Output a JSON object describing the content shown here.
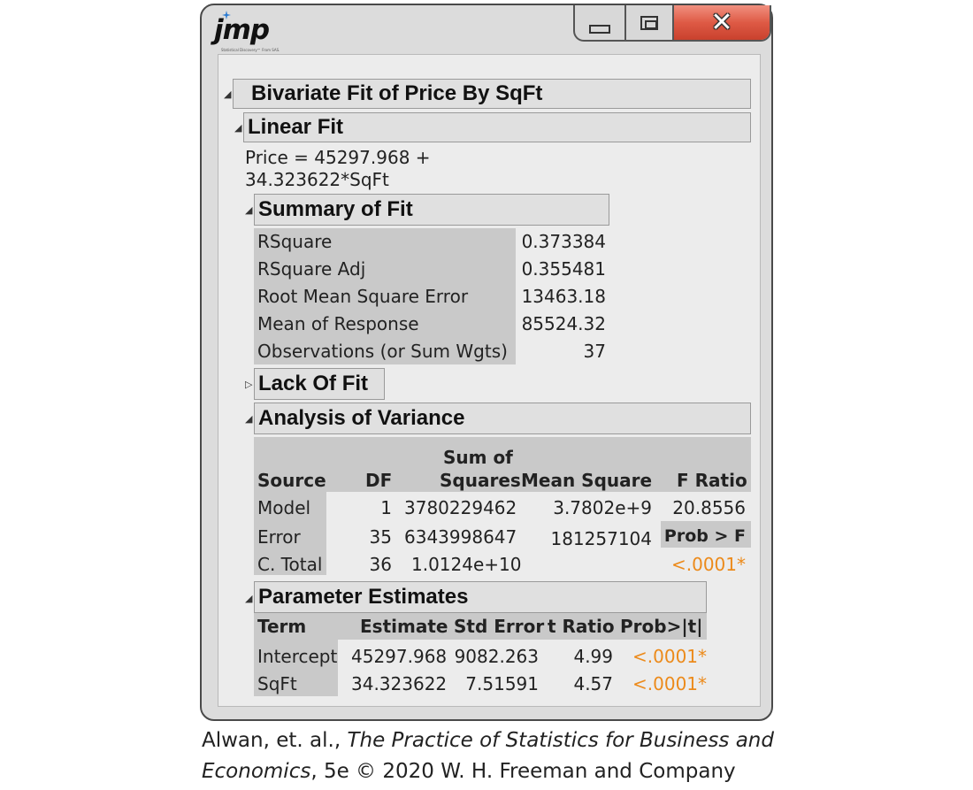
{
  "window": {
    "logo_text": "jmp",
    "logo_tagline": "Statistical Discovery™ From SAS."
  },
  "report": {
    "title": "Bivariate Fit of Price By SqFt",
    "linear_fit": {
      "title": "Linear Fit",
      "equation_line1": "Price = 45297.968 +",
      "equation_line2": "34.323622*SqFt"
    },
    "summary_of_fit": {
      "title": "Summary of Fit",
      "rows": [
        {
          "label": "RSquare",
          "value": "0.373384"
        },
        {
          "label": "RSquare Adj",
          "value": "0.355481"
        },
        {
          "label": "Root Mean Square Error",
          "value": "13463.18"
        },
        {
          "label": "Mean of Response",
          "value": "85524.32"
        },
        {
          "label": "Observations (or Sum Wgts)",
          "value": "37"
        }
      ]
    },
    "lack_of_fit": {
      "title": "Lack Of Fit"
    },
    "anova": {
      "title": "Analysis of Variance",
      "headers": {
        "source": "Source",
        "df": "DF",
        "ss_line1": "Sum of",
        "ss_line2": "Squares",
        "ms": "Mean Square",
        "f": "F Ratio"
      },
      "rows": [
        {
          "source": "Model",
          "df": "1",
          "ss": "3780229462",
          "ms": "3.7802e+9",
          "extra": "20.8556"
        },
        {
          "source": "Error",
          "df": "35",
          "ss": "6343998647",
          "ms": "181257104",
          "extra": "Prob > F"
        },
        {
          "source": "C. Total",
          "df": "36",
          "ss": "1.0124e+10",
          "ms": "",
          "extra": "<.0001*"
        }
      ]
    },
    "parameter_estimates": {
      "title": "Parameter Estimates",
      "headers": {
        "term": "Term",
        "estimate": "Estimate",
        "std_error": "Std Error",
        "t_ratio": "t Ratio",
        "prob": "Prob>|t|"
      },
      "rows": [
        {
          "term": "Intercept",
          "estimate": "45297.968",
          "std_error": "9082.263",
          "t_ratio": "4.99",
          "prob": "<.0001*"
        },
        {
          "term": "SqFt",
          "estimate": "34.323622",
          "std_error": "7.51591",
          "t_ratio": "4.57",
          "prob": "<.0001*"
        }
      ]
    }
  },
  "caption": {
    "part1": "Alwan, et. al., ",
    "title_italic_1": "The Practice of Statistics for Business and",
    "title_italic_2": "Economics",
    "part2": ", 5e © 2020 W. H. Freeman and Company"
  },
  "colors": {
    "significant": "#ec8a1a",
    "close_button": "#de5a45",
    "red_triangle": "#d61e2a"
  }
}
